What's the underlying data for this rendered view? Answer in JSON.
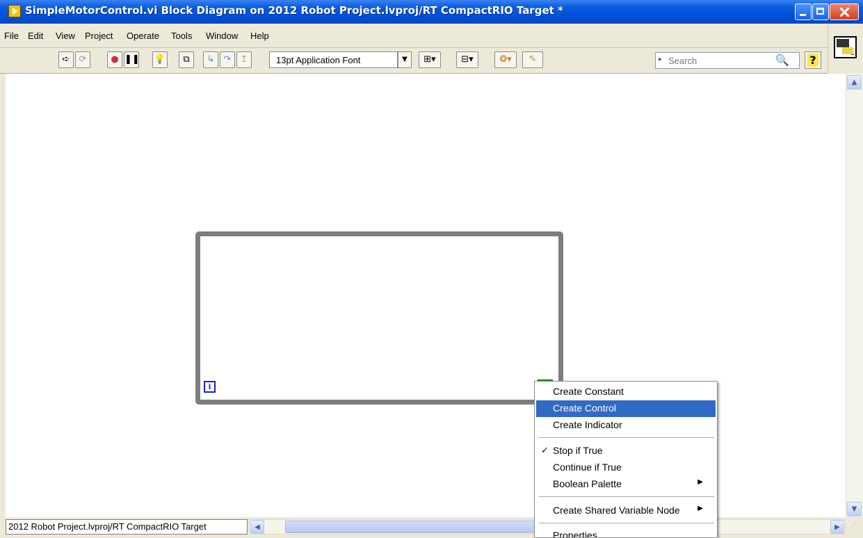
{
  "window": {
    "title": "SimpleMotorControl.vi Block Diagram on 2012 Robot Project.lvproj/RT CompactRIO Target *"
  },
  "menubar": [
    {
      "label": "File",
      "mnemonic": "F"
    },
    {
      "label": "Edit",
      "mnemonic": "E"
    },
    {
      "label": "View",
      "mnemonic": "V"
    },
    {
      "label": "Project",
      "mnemonic": "P"
    },
    {
      "label": "Operate",
      "mnemonic": "O"
    },
    {
      "label": "Tools",
      "mnemonic": "T"
    },
    {
      "label": "Window",
      "mnemonic": "W"
    },
    {
      "label": "Help",
      "mnemonic": "H"
    }
  ],
  "toolbar": {
    "buttons": [
      {
        "name": "run-icon"
      },
      {
        "name": "run-continuously-icon"
      },
      {
        "name": "abort-icon"
      },
      {
        "name": "pause-icon"
      },
      {
        "name": "highlight-execution-icon"
      },
      {
        "name": "retain-wire-values-icon"
      },
      {
        "name": "step-into-icon"
      },
      {
        "name": "step-over-icon"
      },
      {
        "name": "step-out-icon"
      }
    ],
    "font_label": "13pt Application Font",
    "search_placeholder": "Search",
    "help_label": "?"
  },
  "vi_icon": {
    "number": "1"
  },
  "diagram": {
    "loop_type": "while-loop",
    "iteration_terminal": "i"
  },
  "status": {
    "context_text": "2012 Robot Project.lvproj/RT CompactRIO Target"
  },
  "context_menu": {
    "items": [
      {
        "label": "Create Constant"
      },
      {
        "label": "Create Control",
        "highlighted": true
      },
      {
        "label": "Create Indicator"
      },
      {
        "label": "Stop if True",
        "checked": true
      },
      {
        "label": "Continue if True"
      },
      {
        "label": "Boolean Palette",
        "submenu": true
      },
      {
        "label": "Create Shared Variable Node",
        "submenu": true
      },
      {
        "label": "Properties"
      }
    ]
  },
  "colors": {
    "titlebar": "#0054e3",
    "highlight": "#316ac5",
    "loop_border": "#7d7d7d",
    "stop_terminal": "#1a9a2a",
    "iteration_terminal": "#1a1ad0"
  }
}
